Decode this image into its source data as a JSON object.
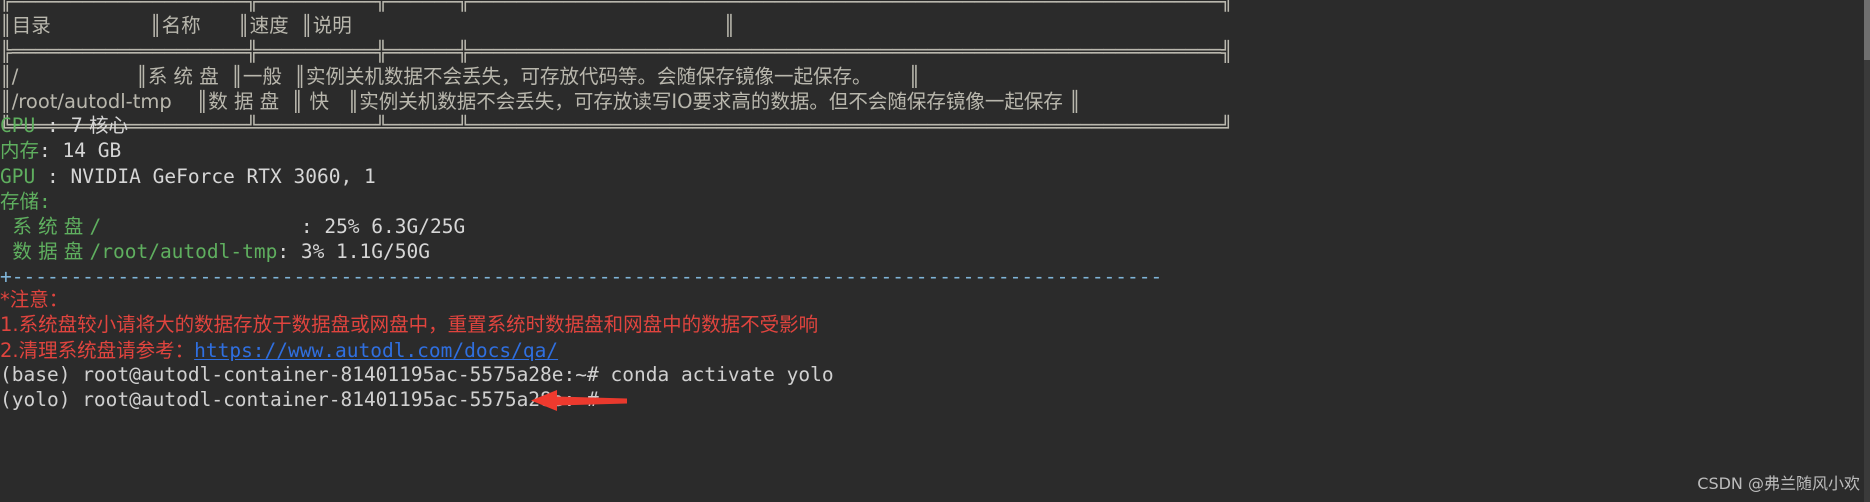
{
  "terminal": {
    "background_color": "#2b2b2b",
    "default_text_color": "#d0d0d0",
    "green_color": "#5faf5f",
    "red_color": "#e0443e",
    "link_color": "#2f6fe0",
    "separator_color": "#7fb4d8"
  },
  "disk_table": {
    "headers": [
      "目录",
      "名称",
      "速度",
      "说明"
    ],
    "rows": [
      {
        "path": "/",
        "name": "系 统 盘",
        "speed": "一般",
        "desc": "实例关机数据不会丢失，可存放代码等。会随保存镜像一起保存。"
      },
      {
        "path": "/root/autodl-tmp",
        "name": "数 据 盘",
        "speed": " 快 ",
        "desc": "实例关机数据不会丢失，可存放读写IO要求高的数据。但不会随保存镜像一起保存"
      }
    ],
    "rendered_lines": [
      "╔════════════════════╦══════════╦══════╦════════════════════════════════════════════════════════════════╗",
      "║目录                ║名称      ║速度  ║说明                                                            ║",
      "╠════════════════════╬══════════╬══════╬════════════════════════════════════════════════════════════════╣",
      "║/                   ║系 统 盘  ║一般  ║实例关机数据不会丢失，可存放代码等。会随保存镜像一起保存。      ║",
      "║/root/autodl-tmp    ║数 据 盘  ║ 快   ║实例关机数据不会丢失，可存放读写IO要求高的数据。但不会随保存镜像一起保存 ║",
      "╚════════════════════╩══════════╩══════╩════════════════════════════════════════════════════════════════╝"
    ]
  },
  "sysinfo": {
    "cpu_label": "CPU ",
    "cpu_sep": ": ",
    "cpu_value": "7 核心",
    "mem_label": "内存",
    "mem_sep": ": ",
    "mem_value": "14 GB",
    "gpu_label": "GPU ",
    "gpu_sep": ": ",
    "gpu_value": "NVIDIA GeForce RTX 3060, 1",
    "storage_label": "存储",
    "storage_sep": ":",
    "disks": [
      {
        "name": "  系 统 盘 ",
        "mount": "/",
        "pad": "                 ",
        "sep": ": ",
        "usage": "25% 6.3G/25G"
      },
      {
        "name": "  数 据 盘 ",
        "mount": "/root/autodl-tmp",
        "pad": "",
        "sep": ": ",
        "usage": "3% 1.1G/50G"
      }
    ]
  },
  "separator": "+--------------------------------------------------------------------------------------------------------------+",
  "notice": {
    "title": "*注意：",
    "item1": "1.系统盘较小请将大的数据存放于数据盘或网盘中，重置系统时数据盘和网盘中的数据不受影响",
    "item2_prefix": "2.清理系统盘请参考：",
    "item2_link": "https://www.autodl.com/docs/qa/"
  },
  "prompts": [
    {
      "env": "(base) ",
      "prompt": "root@autodl-container-81401195ac-5575a28e:~# ",
      "command": "conda activate yolo"
    },
    {
      "env": "(yolo) ",
      "prompt": "root@autodl-container-81401195ac-5575a28e:~# ",
      "command": ""
    }
  ],
  "annotation": {
    "arrow_color": "#ee2222",
    "arrow_direction": "left"
  },
  "watermark": "CSDN @弗兰随风小欢"
}
